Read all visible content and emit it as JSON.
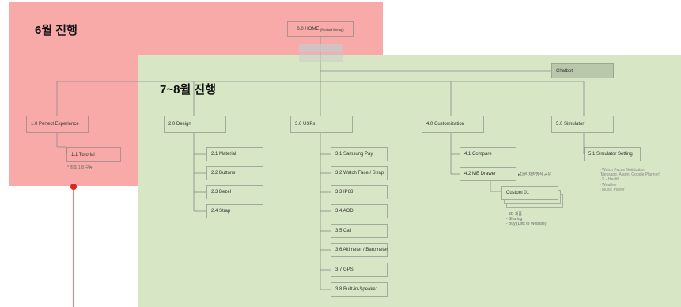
{
  "regions": {
    "june_label": "6월 진행",
    "julaug_label": "7~8월 진행"
  },
  "nodes": {
    "home": "0.0 HOME",
    "home_sub": "(Product line-up)",
    "chatbot": "Chatbot",
    "perfect": "1.0 Perfect Experience",
    "tutorial": "1.1 Tutorial",
    "tutorial_note": "* 최초 1회 구동",
    "design": "2.0 Design",
    "material": "2.1 Material",
    "buttons": "2.2 Buttons",
    "bezel": "2.3 Bezel",
    "strap": "2.4 Strap",
    "usps": "3.0 USPs",
    "samsung_pay": "3.1 Samsung Pay",
    "watch_face": "3.2 Watch Face / Strap",
    "ip68": "3.3 IP68",
    "aod": "3.4 AOD",
    "call": "3.5 Call",
    "altimeter": "3.6 Altimeter / Barometer",
    "gps": "3.7 GPS",
    "speaker": "3.8 Built-in-Speaker",
    "customization": "4.0 Customization",
    "compare": "4.1 Compare",
    "me_drawer": "4.2 ME Drawer",
    "me_drawer_note": "▸다른 저장방식 공유",
    "custom_01": "Custom 01",
    "simulator": "5.0 Simulator",
    "sim_setting": "5.1 Simulator Setting"
  },
  "custom_notes": [
    "- 3D 제품",
    "- Sharing",
    "- Buy (Link to Website)"
  ],
  "simulator_notes": [
    "- Watch Faces Notification",
    "(Message, Alarm, Google Planner)",
    "- S - Health",
    "- Weather",
    "- Music Player"
  ],
  "colors": {
    "june_region": "#f8aaa8",
    "julaug_region": "#d7e6c4",
    "connector": "#8a8a8a",
    "marker": "#e02424"
  }
}
